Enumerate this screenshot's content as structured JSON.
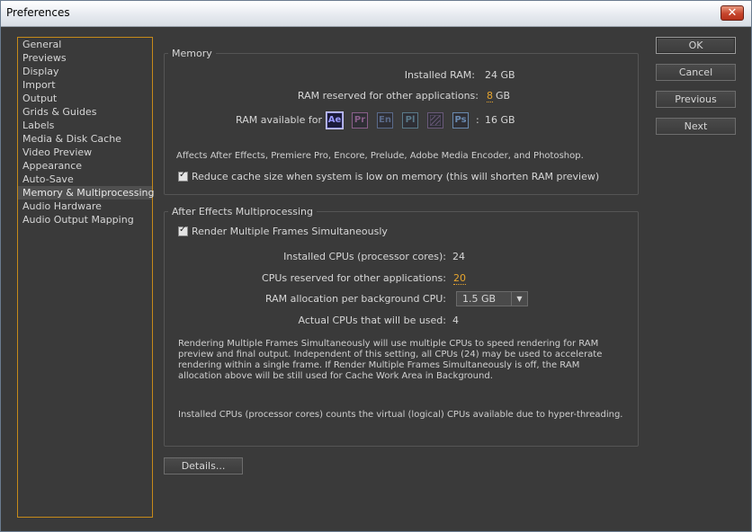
{
  "window": {
    "title": "Preferences",
    "close_label": "✕"
  },
  "sidebar": {
    "items": [
      {
        "label": "General"
      },
      {
        "label": "Previews"
      },
      {
        "label": "Display"
      },
      {
        "label": "Import"
      },
      {
        "label": "Output"
      },
      {
        "label": "Grids & Guides"
      },
      {
        "label": "Labels"
      },
      {
        "label": "Media & Disk Cache"
      },
      {
        "label": "Video Preview"
      },
      {
        "label": "Appearance"
      },
      {
        "label": "Auto-Save"
      },
      {
        "label": "Memory & Multiprocessing",
        "selected": true
      },
      {
        "label": "Audio Hardware"
      },
      {
        "label": "Audio Output Mapping"
      }
    ]
  },
  "memory": {
    "legend": "Memory",
    "installed_ram_label": "Installed RAM:",
    "installed_ram_value": "24 GB",
    "reserved_label": "RAM reserved for other applications:",
    "reserved_value": "8",
    "reserved_unit": "GB",
    "available_label": "RAM available for",
    "apps": [
      {
        "abbr": "Ae",
        "color": "#9999ff",
        "active": true
      },
      {
        "abbr": "Pr",
        "color": "#8a5f8a",
        "active": false
      },
      {
        "abbr": "En",
        "color": "#5a6a8a",
        "active": false
      },
      {
        "abbr": "Pl",
        "color": "#5a7a8a",
        "active": false
      },
      {
        "abbr": "",
        "color": "#6a5a7a",
        "active": false
      },
      {
        "abbr": "Ps",
        "color": "#6a8ab0",
        "active": false
      }
    ],
    "available_colon": ":",
    "available_value": "16 GB",
    "affects_text": "Affects After Effects, Premiere Pro, Encore, Prelude, Adobe Media Encoder, and Photoshop.",
    "reduce_cache_label": "Reduce cache size when system is low on memory (this will shorten RAM preview)",
    "reduce_cache_checked": true
  },
  "multiprocessing": {
    "legend": "After Effects Multiprocessing",
    "render_label": "Render Multiple Frames Simultaneously",
    "render_checked": true,
    "installed_cpus_label": "Installed CPUs (processor cores):",
    "installed_cpus_value": "24",
    "reserved_cpus_label": "CPUs reserved for other applications:",
    "reserved_cpus_value": "20",
    "ram_alloc_label": "RAM allocation per background CPU:",
    "ram_alloc_value": "1.5 GB",
    "actual_label": "Actual CPUs that will be used:",
    "actual_value": "4",
    "description": "Rendering Multiple Frames Simultaneously will use multiple CPUs to speed rendering for RAM preview and final output. Independent of this setting, all CPUs (24) may be used to accelerate rendering within a single frame. If Render Multiple Frames Simultaneously is off, the RAM allocation above will be still used for Cache Work Area in Background.",
    "note": "Installed CPUs (processor cores) counts the virtual (logical) CPUs available due to hyper-threading."
  },
  "details_button": "Details...",
  "buttons": {
    "ok": "OK",
    "cancel": "Cancel",
    "previous": "Previous",
    "next": "Next"
  }
}
